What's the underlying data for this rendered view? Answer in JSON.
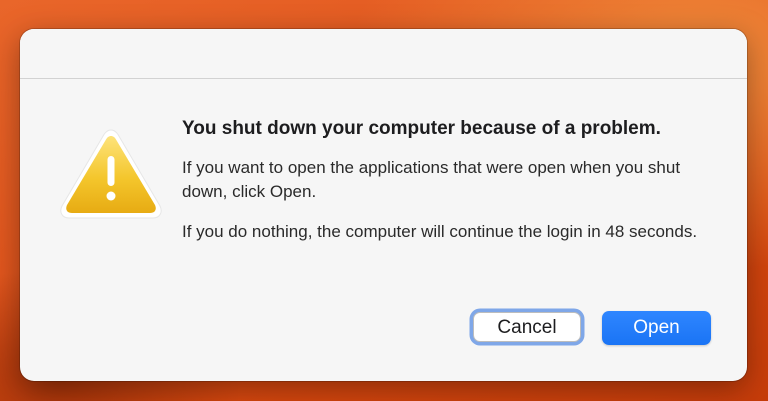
{
  "dialog": {
    "heading": "You shut down your computer because of a problem.",
    "message1": "If you want to open the applications that were open when you shut down, click Open.",
    "message2": "If you do nothing, the computer will continue the login in 48 seconds.",
    "icon": "warning-icon",
    "buttons": {
      "cancel": "Cancel",
      "open": "Open"
    }
  },
  "colors": {
    "accent": "#1a74f5",
    "warning": "#f2c22a",
    "background": "#e0541c"
  }
}
